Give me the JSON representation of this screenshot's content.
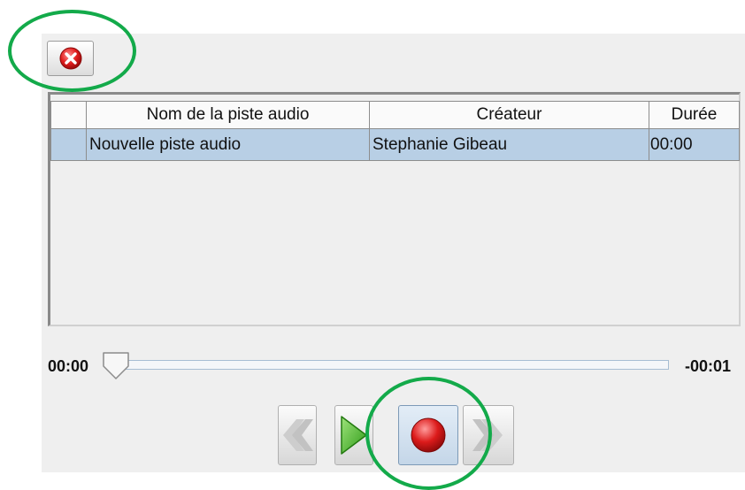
{
  "toolbar": {
    "delete_icon": "delete-track-icon"
  },
  "table": {
    "columns": [
      "",
      "Nom de la piste audio",
      "Créateur",
      "Durée"
    ],
    "rows": [
      {
        "index": "",
        "name": "Nouvelle piste audio",
        "creator": "Stephanie Gibeau",
        "duration": "00:00"
      }
    ]
  },
  "player": {
    "elapsed": "00:00",
    "remaining": "-00:01",
    "position_fraction": 0.0,
    "buttons": [
      "rewind-icon",
      "play-icon",
      "record-icon",
      "fast-forward-icon"
    ]
  },
  "colors": {
    "highlight": "#13aa4a",
    "selected_row": "#b8cfe5",
    "play": "#3fae25",
    "record": "#d81818"
  }
}
